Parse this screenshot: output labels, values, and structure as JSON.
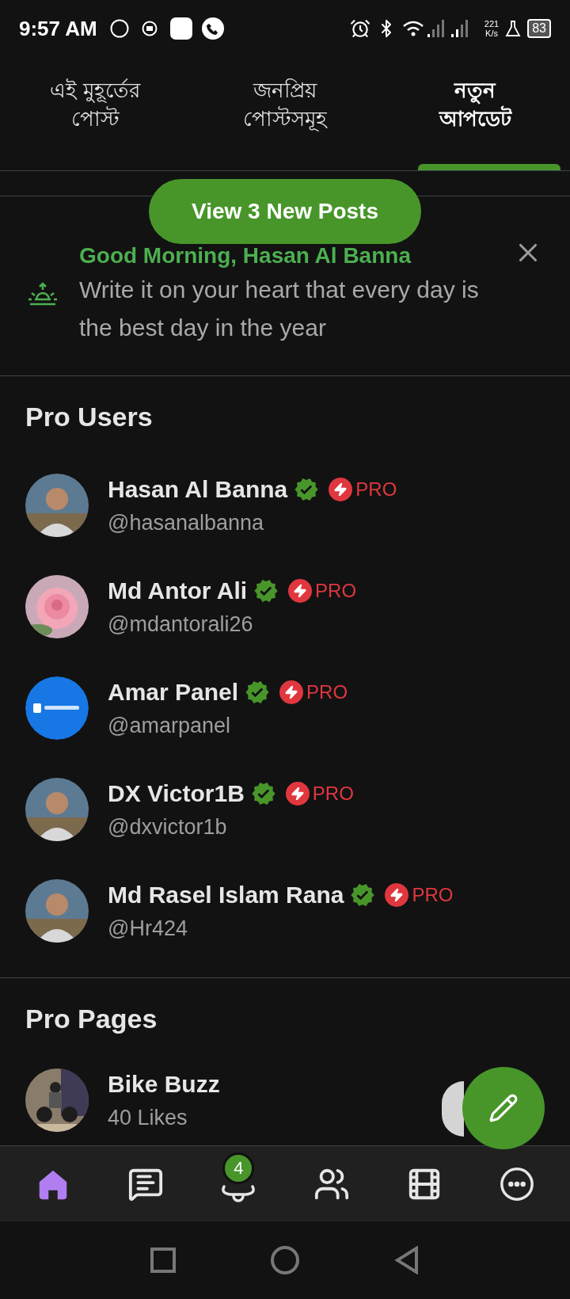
{
  "status_bar": {
    "time": "9:57 AM",
    "speed_value": "221",
    "speed_unit": "K/s",
    "battery": "83"
  },
  "tabs": [
    {
      "label": "এই মুহূর্তের পোস্ট",
      "selected": false
    },
    {
      "label": "জনপ্রিয় পোস্টসমূহ",
      "selected": false
    },
    {
      "label": "নতুন আপডেট",
      "selected": true
    }
  ],
  "new_posts_button": "View 3 New Posts",
  "greeting": {
    "title": "Good Morning, Hasan Al Banna",
    "message": "Write it on your heart that every day is the best day in the year"
  },
  "pro_users": {
    "title": "Pro Users",
    "users": [
      {
        "name": "Hasan Al Banna",
        "handle": "@hasanalbanna",
        "verified": true,
        "badge": "PRO"
      },
      {
        "name": "Md Antor Ali",
        "handle": "@mdantorali26",
        "verified": true,
        "badge": "PRO"
      },
      {
        "name": "Amar Panel",
        "handle": "@amarpanel",
        "verified": true,
        "badge": "PRO"
      },
      {
        "name": "DX Victor1B",
        "handle": "@dxvictor1b",
        "verified": true,
        "badge": "PRO"
      },
      {
        "name": "Md Rasel Islam Rana",
        "handle": "@Hr424",
        "verified": true,
        "badge": "PRO"
      }
    ]
  },
  "pro_pages": {
    "title": "Pro Pages",
    "pages": [
      {
        "name": "Bike Buzz",
        "likes": "40 Likes"
      }
    ]
  },
  "bottom_nav": [
    {
      "kind": "home",
      "selected": true
    },
    {
      "kind": "messages",
      "selected": false
    },
    {
      "kind": "notifications",
      "selected": false,
      "badge": "4"
    },
    {
      "kind": "friends",
      "selected": false
    },
    {
      "kind": "reels",
      "selected": false
    },
    {
      "kind": "more",
      "selected": false
    }
  ]
}
